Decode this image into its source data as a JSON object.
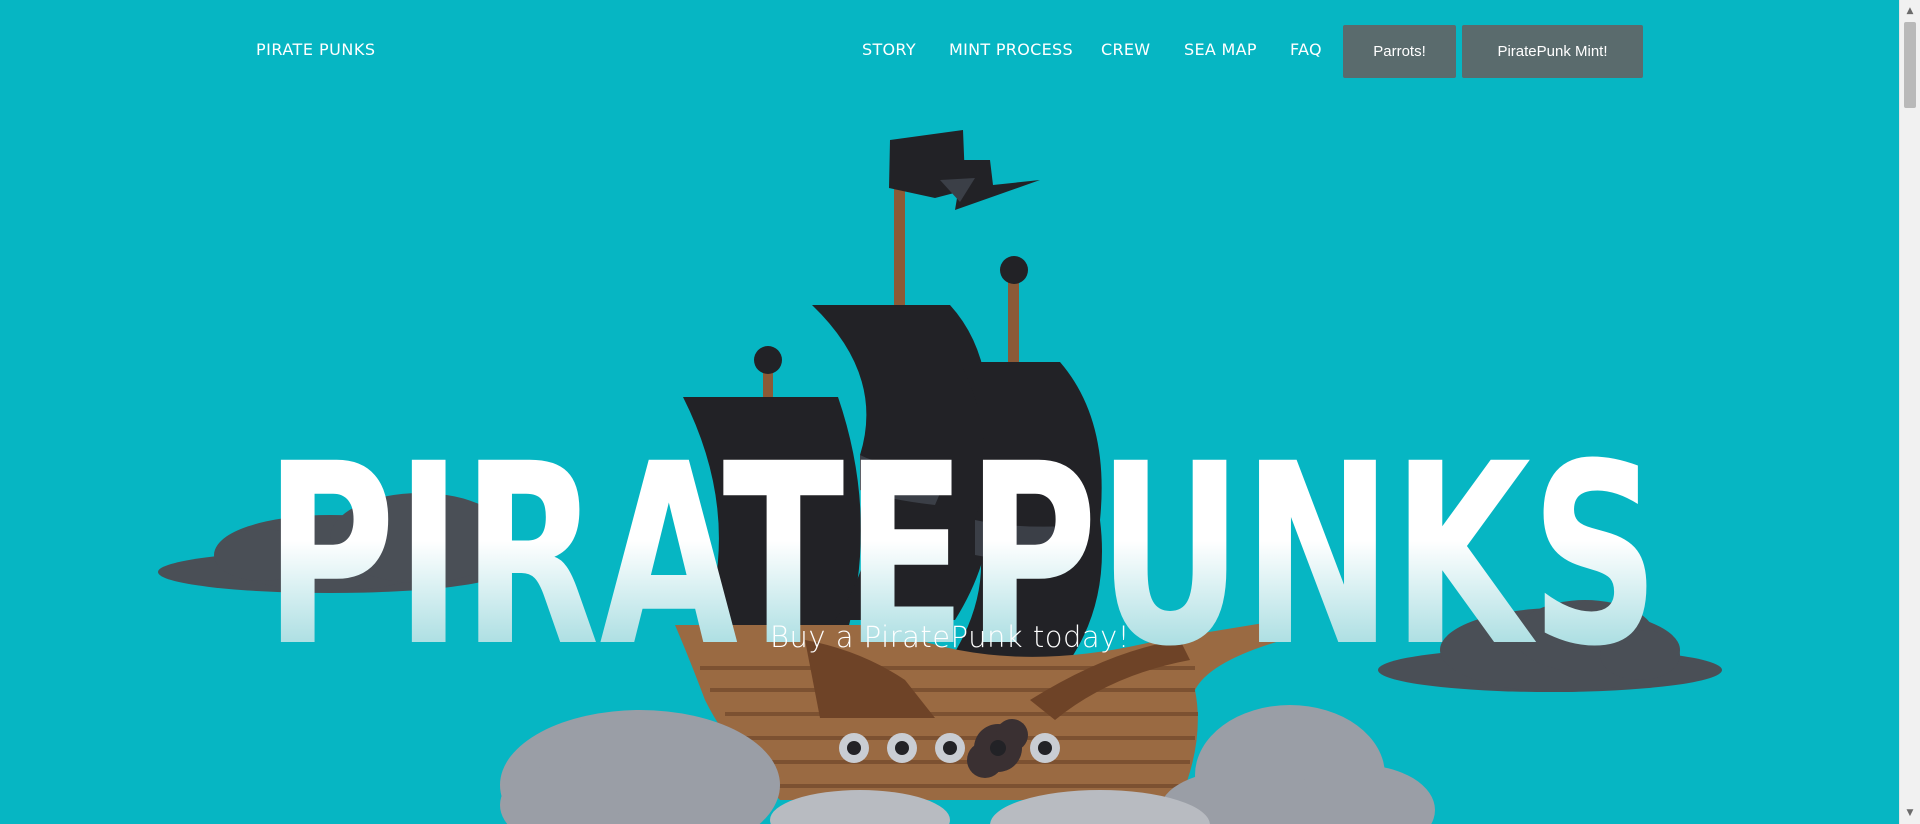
{
  "nav": {
    "brand": "PIRATE PUNKS",
    "links": [
      "STORY",
      "MINT PROCESS",
      "CREW",
      "SEA MAP",
      "FAQ"
    ],
    "buttons": [
      "Parrots!",
      "PiratePunk Mint!"
    ]
  },
  "hero": {
    "title": "PIRATEPUNKS",
    "subtitle": "Buy a PiratePunk today!"
  },
  "colors": {
    "background": "#06b6c3",
    "button": "#5a6b6d",
    "sail": "#222226",
    "hull": "#9a6a42",
    "cloud_dark": "#4a4f56",
    "cloud_light": "#9a9ea6"
  },
  "icons": {
    "scroll_up": "▲",
    "scroll_down": "▼"
  }
}
